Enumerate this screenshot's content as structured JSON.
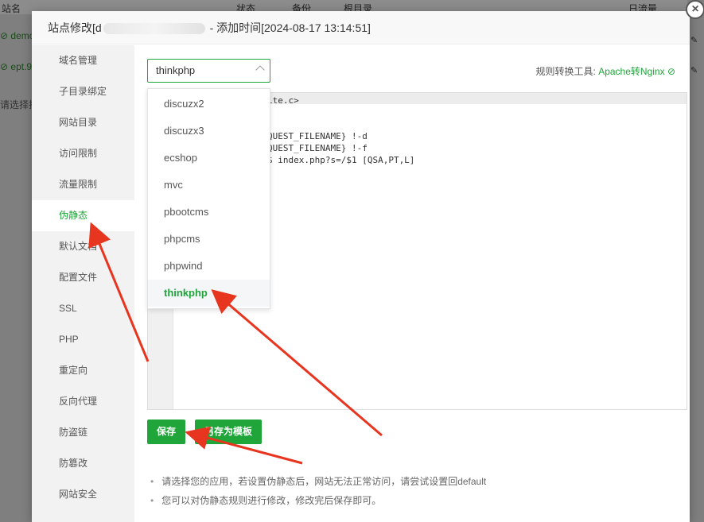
{
  "background": {
    "header_cols": [
      "站名",
      "状态",
      "备份",
      "根目录",
      "日流量"
    ],
    "rows": [
      "demo",
      "ept.9",
      "请选择批"
    ]
  },
  "modal": {
    "title_prefix": "站点修改[d",
    "title_suffix": " - 添加时间[2024-08-17 13:14:51]",
    "close_label": "×"
  },
  "sidebar": {
    "items": [
      "域名管理",
      "子目录绑定",
      "网站目录",
      "访问限制",
      "流量限制",
      "伪静态",
      "默认文档",
      "配置文件",
      "SSL",
      "PHP",
      "重定向",
      "反向代理",
      "防盗链",
      "防篡改",
      "网站安全"
    ],
    "active_index": 5
  },
  "rewrite": {
    "select_value": "thinkphp",
    "tool_label": "规则转换工具:",
    "tool_link": "Apache转Nginx",
    "code_lines": [
      "ite.c>",
      "",
      "",
      "QUEST_FILENAME} !-d",
      "QUEST_FILENAME} !-f",
      "$ index.php?s=/$1 [QSA,PT,L]"
    ],
    "dropdown": [
      "discuzx2",
      "discuzx3",
      "ecshop",
      "mvc",
      "pbootcms",
      "phpcms",
      "phpwind",
      "thinkphp"
    ],
    "dropdown_selected": "thinkphp",
    "save_label": "保存",
    "save_template_label": "另存为模板",
    "notes": [
      "请选择您的应用，若设置伪静态后，网站无法正常访问，请尝试设置回default",
      "您可以对伪静态规则进行修改，修改完后保存即可。"
    ]
  },
  "colors": {
    "accent": "#20a53a",
    "arrow": "#e8351f"
  }
}
